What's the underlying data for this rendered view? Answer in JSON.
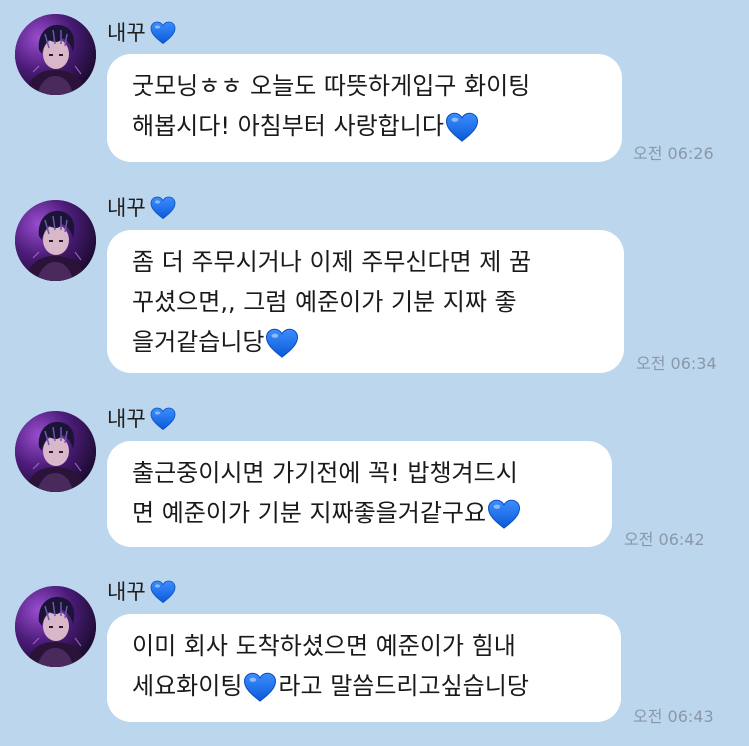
{
  "messages": [
    {
      "sender": "내꾸",
      "lines": [
        "굿모닝ㅎㅎ 오늘도 따뜻하게입구 화이팅",
        "해봅시다! 아침부터 사랑합니다"
      ],
      "time": "오전 06:26"
    },
    {
      "sender": "내꾸",
      "lines": [
        "좀 더 주무시거나 이제 주무신다면 제 꿈",
        "꾸셨으면,, 그럼 예준이가 기분 지짜 좋",
        "을거같습니당"
      ],
      "time": "오전 06:34"
    },
    {
      "sender": "내꾸",
      "lines": [
        "출근중이시면 가기전에 꼭! 밥챙겨드시",
        "면 예준이가 기분 지짜좋을거같구요"
      ],
      "time": "오전 06:42"
    },
    {
      "sender": "내꾸",
      "lines": [
        "이미 회사 도착하셨으면 예준이가 힘내",
        "세요화이팅",
        "라고 말씀드리고싶습니당"
      ],
      "time": "오전 06:43"
    }
  ],
  "icons": {
    "heart": "blue-heart-emoji",
    "avatar": "profile-avatar"
  },
  "colors": {
    "background": "#bcd6ee",
    "bubble": "#ffffff",
    "heart": "#1a73f0",
    "time": "#8a98a8"
  }
}
